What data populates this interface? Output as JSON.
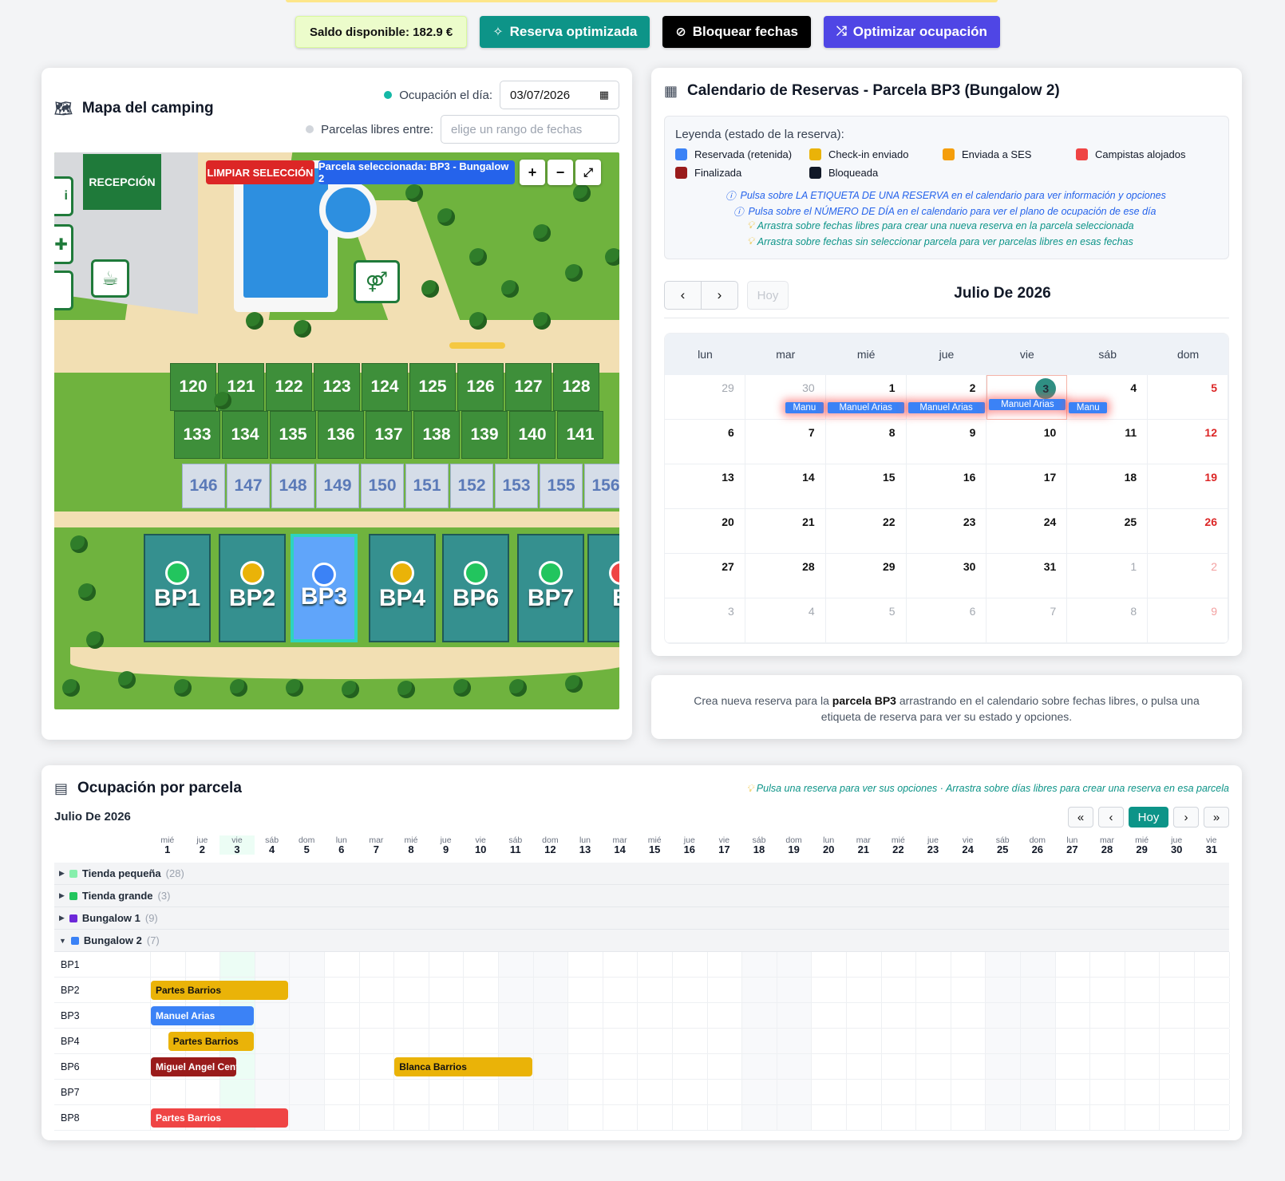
{
  "topbar": {
    "balance": "Saldo disponible: 182.9 €",
    "btn_optimized": "Reserva optimizada",
    "btn_block": "Bloquear fechas",
    "btn_optimize": "Optimizar ocupación"
  },
  "map": {
    "title": "Mapa del camping",
    "occupancy_label": "Ocupación el día:",
    "occupancy_date": "03/07/2026",
    "free_label": "Parcelas libres entre:",
    "free_placeholder": "elige un rango de fechas",
    "clear_btn": "LIMPIAR SELECCIÓN",
    "selected_label": "Parcela seleccionada: BP3 - Bungalow 2",
    "reception": "RECEPCIÓN",
    "row1": [
      "120",
      "121",
      "122",
      "123",
      "124",
      "125",
      "126",
      "127",
      "128"
    ],
    "row2": [
      "133",
      "134",
      "135",
      "136",
      "137",
      "138",
      "139",
      "140",
      "141"
    ],
    "row3": [
      "146",
      "147",
      "148",
      "149",
      "150",
      "151",
      "152",
      "153",
      "155",
      "156"
    ],
    "bungalows": [
      {
        "label": "BP1",
        "status_color": "#22c55e"
      },
      {
        "label": "BP2",
        "status_color": "#eab308"
      },
      {
        "label": "BP3",
        "status_color": "#3b82f6"
      },
      {
        "label": "BP4",
        "status_color": "#eab308"
      },
      {
        "label": "BP6",
        "status_color": "#22c55e"
      },
      {
        "label": "BP7",
        "status_color": "#22c55e"
      },
      {
        "label": "B",
        "status_color": "#ef4444"
      }
    ]
  },
  "calendar": {
    "title": "Calendario de Reservas - Parcela BP3 (Bungalow 2)",
    "legend_title": "Leyenda (estado de la reserva):",
    "legend": [
      {
        "label": "Reservada (retenida)",
        "color": "#3b82f6"
      },
      {
        "label": "Check-in enviado",
        "color": "#eab308"
      },
      {
        "label": "Enviada a SES",
        "color": "#f59e0b"
      },
      {
        "label": "Campistas alojados",
        "color": "#ef4444"
      },
      {
        "label": "Finalizada",
        "color": "#991b1b"
      },
      {
        "label": "Bloqueada",
        "color": "#111827"
      }
    ],
    "hints": [
      "Pulsa sobre LA ETIQUETA DE UNA RESERVA en el calendario para ver información y opciones",
      "Pulsa sobre el NÚMERO DE DÍA en el calendario para ver el plano de ocupación de ese día",
      "Arrastra sobre fechas libres para crear una nueva reserva en la parcela seleccionada",
      "Arrastra sobre fechas sin seleccionar parcela para ver parcelas libres en esas fechas"
    ],
    "today_btn": "Hoy",
    "month": "Julio De 2026",
    "weekdays": [
      "lun",
      "mar",
      "mié",
      "jue",
      "vie",
      "sáb",
      "dom"
    ],
    "days": [
      "29",
      "30",
      "1",
      "2",
      "3",
      "4",
      "5",
      "6",
      "7",
      "8",
      "9",
      "10",
      "11",
      "12",
      "13",
      "14",
      "15",
      "16",
      "17",
      "18",
      "19",
      "20",
      "21",
      "22",
      "23",
      "24",
      "25",
      "26",
      "27",
      "28",
      "29",
      "30",
      "31",
      "1",
      "2",
      "3",
      "4",
      "5",
      "6",
      "7",
      "8",
      "9"
    ],
    "events": [
      "Manu",
      "Manuel Arias",
      "Manuel Arias",
      "Manuel Arias",
      "Manu"
    ]
  },
  "info": {
    "pre": "Crea nueva reserva para la ",
    "bold": "parcela BP3",
    "post": " arrastrando en el calendario sobre fechas libres, o pulsa una etiqueta de reserva para ver su estado y opciones."
  },
  "occupancy": {
    "title": "Ocupación por parcela",
    "hint": "Pulsa una reserva para ver sus opciones · Arrastra sobre días libres para crear una reserva en esa parcela",
    "month": "Julio De 2026",
    "nav": [
      "«",
      "‹",
      "Hoy",
      "›",
      "»"
    ],
    "dow": [
      "mié",
      "jue",
      "vie",
      "sáb",
      "dom",
      "lun",
      "mar",
      "mié",
      "jue",
      "vie",
      "sáb",
      "dom",
      "lun",
      "mar",
      "mié",
      "jue",
      "vie",
      "sáb",
      "dom",
      "lun",
      "mar",
      "mié",
      "jue",
      "vie",
      "sáb",
      "dom",
      "lun",
      "mar",
      "mié",
      "jue",
      "vie"
    ],
    "groups": [
      {
        "name": "Tienda pequeña",
        "count": "(28)",
        "color": "#86efac",
        "arrow": "▶"
      },
      {
        "name": "Tienda grande",
        "count": "(3)",
        "color": "#22c55e",
        "arrow": "▶"
      },
      {
        "name": "Bungalow 1",
        "count": "(9)",
        "color": "#6d28d9",
        "arrow": "▶"
      },
      {
        "name": "Bungalow 2",
        "count": "(7)",
        "color": "#3b82f6",
        "arrow": "▼"
      }
    ],
    "parcels": [
      {
        "name": "BP1",
        "bookings": []
      },
      {
        "name": "BP2",
        "bookings": [
          {
            "guest": "Partes Barrios",
            "start": 1,
            "end": 5,
            "color": "#eab308"
          }
        ]
      },
      {
        "name": "BP3",
        "bookings": [
          {
            "guest": "Manuel Arias",
            "start": 1,
            "end": 4,
            "color": "#3b82f6"
          }
        ]
      },
      {
        "name": "BP4",
        "bookings": [
          {
            "guest": "Partes Barrios",
            "start": 1.5,
            "end": 4,
            "color": "#eab308"
          }
        ]
      },
      {
        "name": "BP6",
        "bookings": [
          {
            "guest": "Miguel Angel Cente",
            "start": 1,
            "end": 3.5,
            "color": "#991b1b"
          },
          {
            "guest": "Blanca Barrios",
            "start": 8,
            "end": 12,
            "color": "#eab308"
          }
        ]
      },
      {
        "name": "BP7",
        "bookings": []
      },
      {
        "name": "BP8",
        "bookings": [
          {
            "guest": "Partes Barrios",
            "start": 1,
            "end": 5,
            "color": "#ef4444"
          }
        ]
      }
    ]
  }
}
